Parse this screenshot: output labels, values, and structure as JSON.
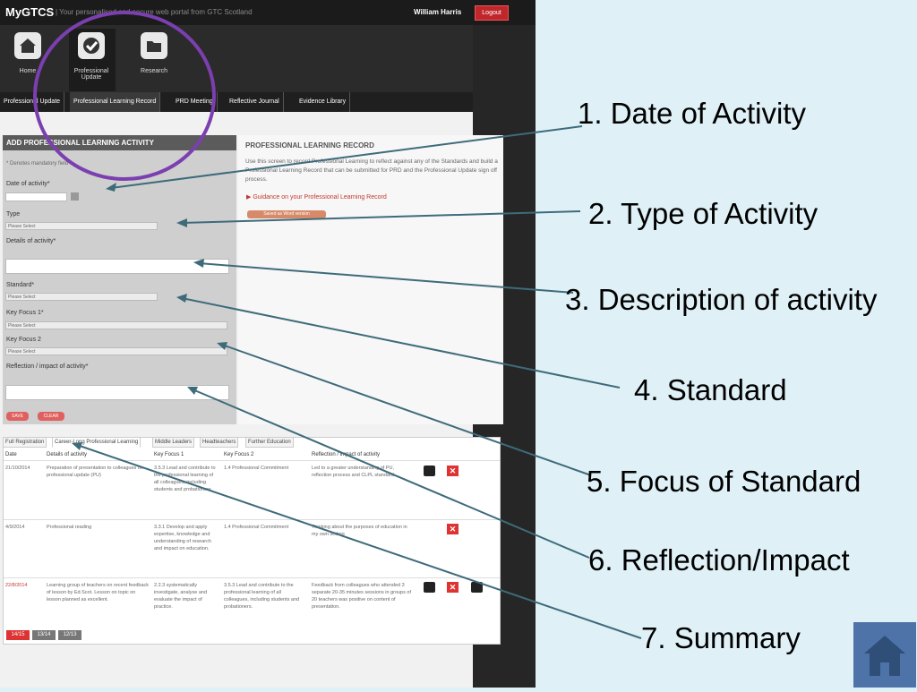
{
  "app": {
    "logo": "MyGTCS",
    "tagline": "|  Your personalised and secure web portal from GTC Scotland",
    "user": "William Harris",
    "logout": "Logout"
  },
  "nav_icons": [
    {
      "label": "Home"
    },
    {
      "label": "Professional Update"
    },
    {
      "label": "Research"
    }
  ],
  "tabs": [
    "Professional Update",
    "Professional Learning Record",
    "PRD Meeting",
    "Reflective Journal",
    "Evidence Library"
  ],
  "form": {
    "header": "ADD PROFESSIONAL LEARNING ACTIVITY",
    "required_note": "* Denotes mandatory field",
    "date_label": "Date of activity*",
    "type_label": "Type",
    "type_value": "Please Select",
    "details_label": "Details of activity*",
    "standard_label": "Standard*",
    "standard_value": "Please Select",
    "key_focus_1_label": "Key Focus 1*",
    "key_focus_1_value": "Please Select",
    "key_focus_2_label": "Key Focus 2",
    "key_focus_2_value": "Please Select",
    "reflection_label": "Reflection / impact of activity*",
    "save": "SAVE",
    "clear": "CLEAR"
  },
  "info": {
    "title": "PROFESSIONAL LEARNING RECORD",
    "text": "Use this screen to record Professional Learning to reflect against any of the Standards and build a Professional Learning Record that can be submitted for PRD and the Professional Update sign off process.",
    "guidance": "Guidance on your Professional Learning Record",
    "word_button": "Saved as Word version"
  },
  "table": {
    "tabs": [
      "Full Registration",
      "Career-Long Professional Learning",
      "Middle Leaders",
      "Headteachers",
      "Further Education"
    ],
    "headers": [
      "Date",
      "Details of activity",
      "Key Focus 1",
      "Key Focus 2",
      "Reflection / impact of activity"
    ],
    "rows": [
      {
        "date": "21/10/2014",
        "details": "Preparation of presentation to colleagues on professional update (PU)",
        "kf1": "3.5.3 Lead and contribute to the professional learning of all colleagues, including students and probationers.",
        "kf2": "1.4 Professional Commitment",
        "reflection": "Led to a greater understanding of PU, reflection process and CLPL standard."
      },
      {
        "date": "4/9/2014",
        "details": "Professional reading",
        "kf1": "3.3.1 Develop and apply expertise, knowledge and understanding of research and impact on education.",
        "kf2": "1.4 Professional Commitment",
        "reflection": "Thinking about the purposes of education in my own setting"
      },
      {
        "date": "22/8/2014",
        "details": "Learning group of teachers on recent feedback of lesson by Ed.Scot. Lesson on topic on lesson planned as excellent.",
        "kf1": "2.2.3 systematically investigate, analyse and evaluate the impact of practice.",
        "kf2": "3.5.3 Lead and contribute to the professional learning of all colleagues, including students and probationers.",
        "reflection": "Feedback from colleagues who attended 3 separate 20-35 minutes sessions in groups of 20 teachers was positive on content of presentation."
      }
    ],
    "pages": [
      "14/15",
      "13/14",
      "12/13"
    ]
  },
  "annotations": [
    "1. Date of Activity",
    "2. Type of Activity",
    "3. Description of activity",
    "4. Standard",
    "5. Focus of Standard",
    "6. Reflection/Impact",
    "7. Summary"
  ],
  "colors": {
    "accent_red": "#c0272d",
    "highlight_circle": "#7b3fb0",
    "arrow": "#3e6b7a",
    "background": "#dff1f7"
  }
}
